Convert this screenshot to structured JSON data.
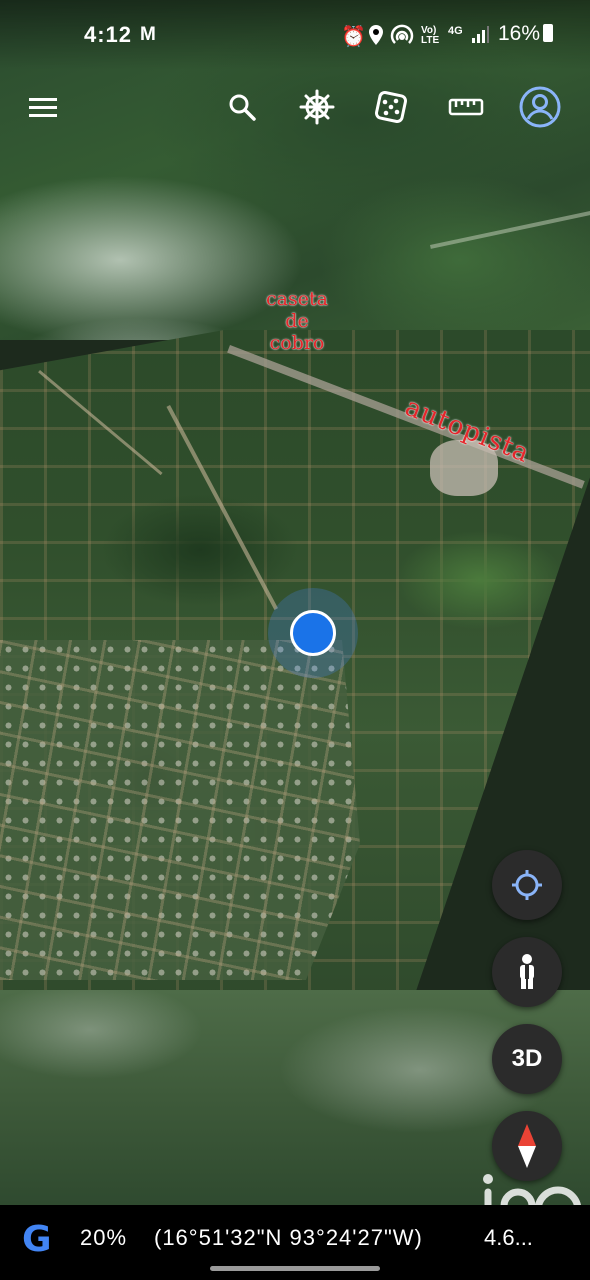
{
  "status_bar": {
    "time": "4:12",
    "carrier_icon": "M",
    "network": "LTE",
    "network_extra": "4G",
    "battery": "16%"
  },
  "toolbar": {
    "icons": [
      "menu-icon",
      "search-icon",
      "voyager-wheel-icon",
      "random-dice-icon",
      "ruler-icon",
      "account-icon"
    ]
  },
  "map": {
    "annotations": {
      "caseta_line1": "caseta",
      "caseta_line2": "de",
      "caseta_line3": "cobro",
      "autopista": "autopista"
    },
    "annotation_color": "#e5262b",
    "location_color": "#1a73e8"
  },
  "fabs": {
    "my_location_icon": "crosshair-icon",
    "street_view_icon": "pegman-icon",
    "three_d_label": "3D",
    "compass_icon": "compass-icon"
  },
  "bottom_bar": {
    "logo": "G",
    "zoom": "20%",
    "coordinates": "(16°51'32\"N 93°24'27\"W)",
    "altitude": "4.6..."
  },
  "watermark": {
    "text": "iad"
  }
}
